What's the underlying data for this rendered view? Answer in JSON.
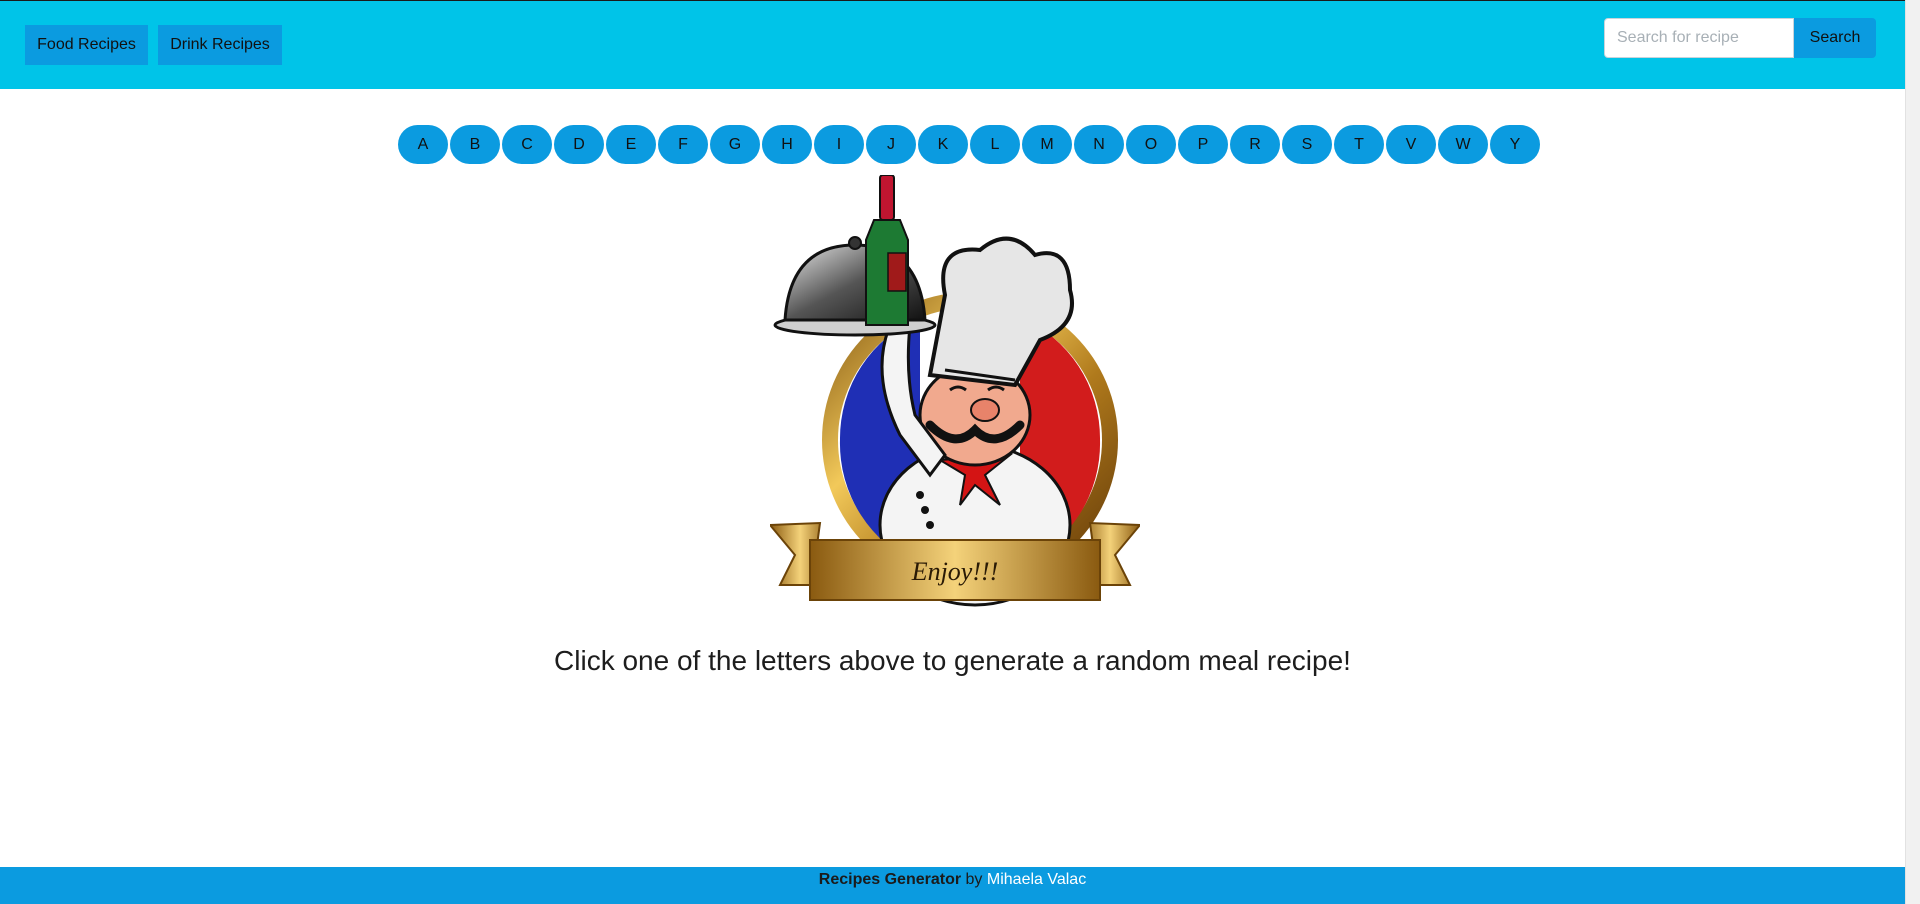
{
  "nav": {
    "food_label": "Food Recipes",
    "drink_label": "Drink Recipes"
  },
  "search": {
    "placeholder": "Search for recipe",
    "value": "",
    "button_label": "Search"
  },
  "letters": [
    "A",
    "B",
    "C",
    "D",
    "E",
    "F",
    "G",
    "H",
    "I",
    "J",
    "K",
    "L",
    "M",
    "N",
    "O",
    "P",
    "R",
    "S",
    "T",
    "V",
    "W",
    "Y"
  ],
  "hero": {
    "banner_text": "Enjoy!!!",
    "instruction": "Click one of the letters above to generate a random meal recipe!"
  },
  "footer": {
    "brand": "Recipes Generator",
    "by": "by",
    "author": "Mihaela Valac"
  },
  "colors": {
    "header_bg": "#00c4e8",
    "button_bg": "#0b9be0",
    "footer_bg": "#0b9be0"
  }
}
